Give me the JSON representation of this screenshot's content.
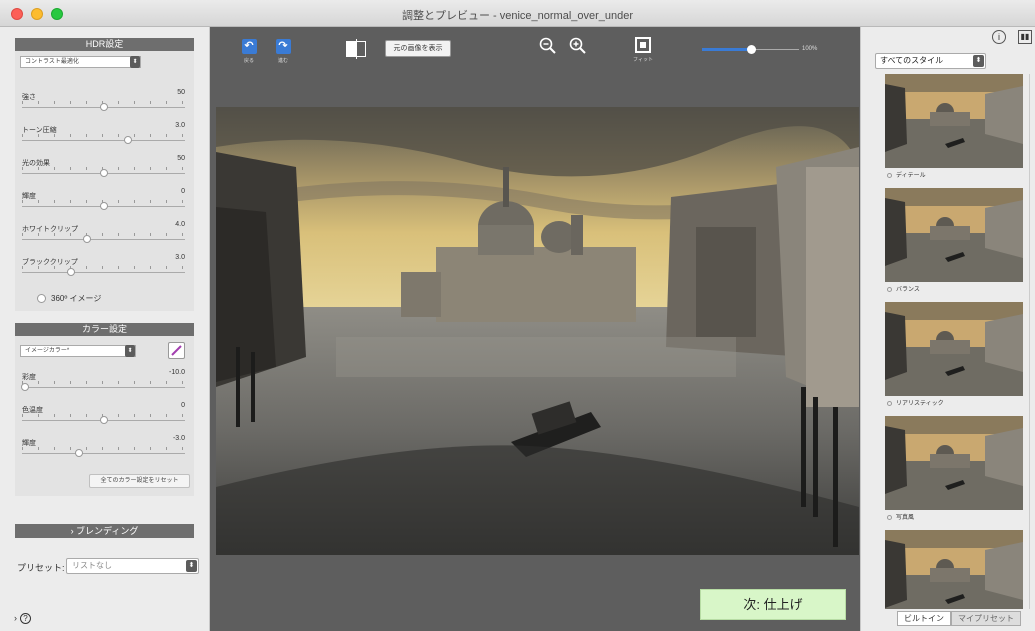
{
  "window": {
    "title": "調整とプレビュー - venice_normal_over_under"
  },
  "hdr": {
    "header": "HDR設定",
    "preset_select": "コントラスト最適化",
    "sliders": [
      {
        "label": "強さ",
        "value": "50",
        "pos": 0.5
      },
      {
        "label": "トーン圧縮",
        "value": "3.0",
        "pos": 0.65
      },
      {
        "label": "光の効果",
        "value": "50",
        "pos": 0.5
      },
      {
        "label": "輝度",
        "value": "0",
        "pos": 0.5
      },
      {
        "label": "ホワイトクリップ",
        "value": "4.0",
        "pos": 0.4
      },
      {
        "label": "ブラッククリップ",
        "value": "3.0",
        "pos": 0.3
      }
    ],
    "image360": "360º イメージ"
  },
  "color": {
    "header": "カラー設定",
    "preset_select": "イメージカラー*",
    "sliders": [
      {
        "label": "彩度",
        "value": "-10.0",
        "pos": 0.02
      },
      {
        "label": "色温度",
        "value": "0",
        "pos": 0.5
      },
      {
        "label": "輝度",
        "value": "-3.0",
        "pos": 0.35
      }
    ],
    "reset": "全てのカラー設定をリセット"
  },
  "blending": {
    "header": "› ブレンディング"
  },
  "preset": {
    "label": "プリセット:",
    "value": "リストなし"
  },
  "help": {
    "prefix": "›"
  },
  "toolbar": {
    "undo": "戻る",
    "redo": "進む",
    "show_original": "元の画像を表示",
    "fit": "フィット",
    "zoom_pct": "100%",
    "zoom_level": 0.5
  },
  "next_button": "次: 仕上げ",
  "styles": {
    "select": "すべてのスタイル",
    "items": [
      {
        "label": "ディテール"
      },
      {
        "label": "バランス"
      },
      {
        "label": "リアリスティック"
      },
      {
        "label": "写真風"
      },
      {
        "label": ""
      }
    ],
    "tabs": [
      "ビルトイン",
      "マイプリセット"
    ]
  },
  "colors": {
    "accent": "#3a7bd5",
    "next_bg": "#d8f6c8",
    "panel_header": "#6e6e6e"
  }
}
